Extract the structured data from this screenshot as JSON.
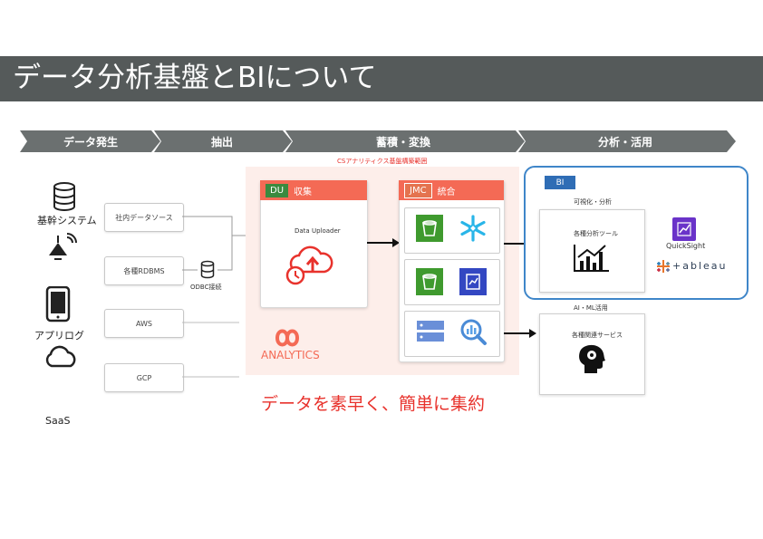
{
  "title": "データ分析基盤とBIについて",
  "steps": [
    "データ発生",
    "抽出",
    "蓄積・変換",
    "分析・活用"
  ],
  "sources": {
    "core_system": "基幹システム",
    "app_log": "アプリログ",
    "saas": "SaaS",
    "boxes": [
      "社内データソース",
      "各種RDBMS",
      "AWS",
      "GCP"
    ],
    "odbc": "ODBC接続"
  },
  "analytics": {
    "caption": "CSアナリティクス基盤構築範囲",
    "du_tag": "DU",
    "du_label": "収集",
    "du_app": "Data Uploader",
    "jmc_tag": "JMC",
    "jmc_label": "統合",
    "logo_text": "ANALYTICS"
  },
  "bi": {
    "tag": "BI",
    "visualize_label": "可視化・分析",
    "tools_label": "各種分析ツール",
    "quicksight": "QuickSight",
    "tableau": "+ableau"
  },
  "ai": {
    "label": "AI・ML活用",
    "services": "各種関連サービス"
  },
  "tagline": "データを素早く、簡単に集約",
  "colors": {
    "accent": "#f46a55",
    "title_bg": "#555a5a",
    "step_bg": "#6b7070",
    "bi_border": "#3f86c9",
    "bi_tag": "#2f6db5",
    "du_tag": "#3a8a3f",
    "jmc_tag": "#e4734f",
    "caption_red": "#e8322c"
  },
  "icons": [
    "database-icon",
    "iot-lamp-icon",
    "smartphone-icon",
    "cloud-icon",
    "cloud-upload-icon",
    "s3-bucket-icon",
    "snowflake-icon",
    "redshift-icon",
    "server-icon",
    "search-chart-icon",
    "bar-chart-icon",
    "quicksight-icon",
    "tableau-icon",
    "ai-head-icon"
  ]
}
